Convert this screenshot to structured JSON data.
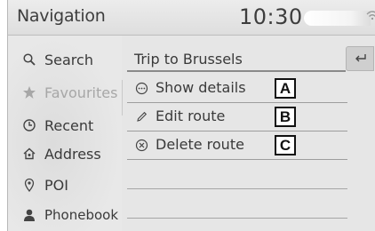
{
  "header": {
    "title": "Navigation",
    "clock": "10:30"
  },
  "sidebar": {
    "items": [
      {
        "label": "Search",
        "icon": "search-icon"
      },
      {
        "label": "Favourites",
        "icon": "star-icon",
        "selected": true
      },
      {
        "label": "Recent",
        "icon": "clock-icon"
      },
      {
        "label": "Address",
        "icon": "house-icon"
      },
      {
        "label": "POI",
        "icon": "location-pin-icon"
      },
      {
        "label": "Phonebook",
        "icon": "person-icon"
      }
    ]
  },
  "main": {
    "title": "Trip to Brussels",
    "back_icon": "return-arrow-icon",
    "rows": [
      {
        "label": "Show details",
        "icon": "ellipsis-circle-icon",
        "callout": "A"
      },
      {
        "label": "Edit route",
        "icon": "pencil-icon",
        "callout": "B"
      },
      {
        "label": "Delete route",
        "icon": "x-circle-icon",
        "callout": "C"
      }
    ]
  },
  "colors": {
    "background": "#e6e6e6",
    "text": "#3a3a3a",
    "selected_text": "#a7a7a7"
  }
}
